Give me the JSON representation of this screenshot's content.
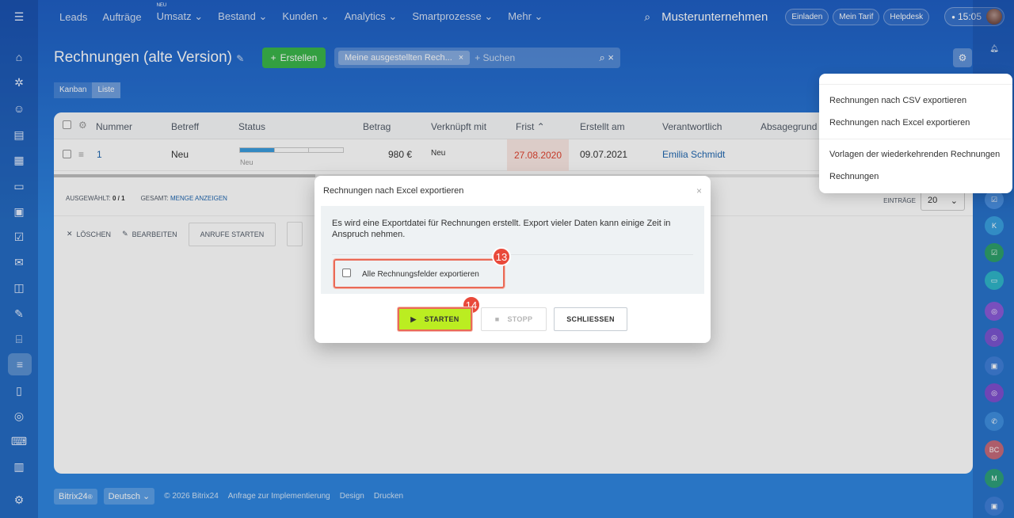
{
  "topbar": {
    "nav": [
      {
        "label": "Leads"
      },
      {
        "label": "Aufträge"
      },
      {
        "label": "Umsatz",
        "badge": "NEU",
        "chevron": true
      },
      {
        "label": "Bestand",
        "chevron": true
      },
      {
        "label": "Kunden",
        "chevron": true
      },
      {
        "label": "Analytics",
        "chevron": true
      },
      {
        "label": "Smartprozesse",
        "chevron": true
      },
      {
        "label": "Mehr",
        "chevron": true
      }
    ],
    "company": "Musterunternehmen",
    "invite": "Einladen",
    "plan": "Mein Tarif",
    "helpdesk": "Helpdesk",
    "time": "15:05"
  },
  "page": {
    "title": "Rechnungen (alte Version)",
    "create_button": "Erstellen",
    "filter_chip": "Meine ausgestellten Rech...",
    "search_placeholder": "+ Suchen",
    "view_tabs": [
      "Kanban",
      "Liste"
    ],
    "active_view": "Liste"
  },
  "grid": {
    "columns": [
      "Nummer",
      "Betreff",
      "Status",
      "Betrag",
      "Verknüpft mit",
      "Frist",
      "Erstellt am",
      "Verantwortlich",
      "Absagegrund"
    ],
    "rows": [
      {
        "number": "1",
        "subject": "Neu",
        "status_label": "Neu",
        "status_progress": 0.33,
        "amount": "980 €",
        "linked": "Neu",
        "deadline": "27.08.2020",
        "created": "09.07.2021",
        "responsible": "Emilia Schmidt"
      }
    ],
    "selected_label": "AUSGEWÄHLT:",
    "selected_value": "0 / 1",
    "total_label": "GESAMT:",
    "total_link": "MENGE ANZEIGEN",
    "entries_label": "EINTRÄGE",
    "entries_value": "20",
    "actions": {
      "delete": "LÖSCHEN",
      "edit": "BEARBEITEN",
      "calls": "ANRUFE STARTEN"
    }
  },
  "settings_menu": {
    "items": [
      "Rechnungen nach CSV exportieren",
      "Rechnungen nach Excel exportieren",
      "Vorlagen der wiederkehrenden Rechnungen",
      "Rechnungen"
    ]
  },
  "dialog": {
    "title": "Rechnungen nach Excel exportieren",
    "text": "Es wird eine Exportdatei für Rechnungen erstellt. Export vieler Daten kann einige Zeit in Anspruch nehmen.",
    "checkbox_label": "Alle Rechnungsfelder exportieren",
    "start": "STARTEN",
    "stop": "STOPP",
    "close": "SCHLIESSEN",
    "badge_checkbox": "13",
    "badge_start": "14"
  },
  "footer": {
    "brand": "Bitrix24",
    "language": "Deutsch",
    "copyright": "© 2026 Bitrix24",
    "links": [
      "Anfrage zur Implementierung",
      "Design",
      "Drucken"
    ]
  },
  "right_bar": {
    "avatars": [
      "K",
      "BC",
      "M"
    ]
  },
  "colors": {
    "accent_green": "#3bb54a",
    "start_button": "#bbed21",
    "highlight_red": "#ea6a56",
    "deadline_red": "#e0422f",
    "link_blue": "#2067b0"
  }
}
